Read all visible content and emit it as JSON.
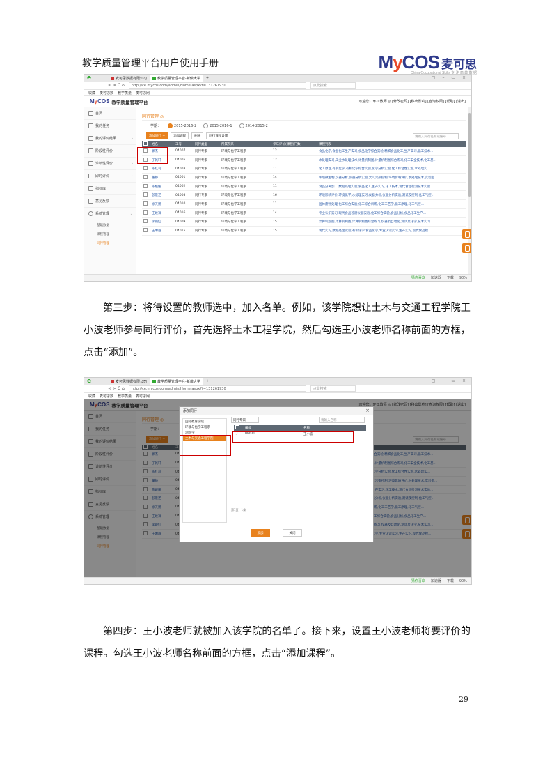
{
  "header": {
    "doc_title": "教学质量管理平台用户使用手册",
    "logo_en_1": "M",
    "logo_en_2": "y",
    "logo_en_3": "COS",
    "logo_cn": "麦可思",
    "logo_sub": "China Occupational Skills  专 注  高 教 数 据"
  },
  "browser": {
    "tab1": "麦可思数据有限公司",
    "tab2": "教学质量管理平台-新做大学",
    "tab_new": "+",
    "window_controls": "▢ – ▭ ×",
    "nav_icons": "<  >  C  ⌂",
    "url": "http://ce.mycos.com/admin/Home.aspx?t=131261930",
    "search_placeholder": "点此搜索",
    "bookmarks": [
      "收藏",
      "麦可思数",
      "教学质量",
      "麦可思网"
    ],
    "status_items": [
      "猜你喜欢",
      "加速器",
      "下载",
      "90%"
    ]
  },
  "app": {
    "logo_m": "M",
    "logo_y": "y",
    "logo_cos": "COS",
    "title": "教学质量管理平台",
    "userbar": "欢迎您，环工教师 ◎  [修改密码] [移出影响] [查询权限] [帮助] [退出]"
  },
  "sidebar": {
    "items": [
      {
        "label": "首页"
      },
      {
        "label": "我的任务"
      },
      {
        "label": "我的评价结果"
      },
      {
        "label": "阶段性评价"
      },
      {
        "label": "诊断性评价"
      },
      {
        "label": "即时评价"
      },
      {
        "label": "指标库"
      },
      {
        "label": "意见反馈"
      },
      {
        "label": "系统管理"
      }
    ],
    "subitems": [
      "基础数据",
      "课程管理",
      "同行管理"
    ]
  },
  "content": {
    "breadcrumb": "同行管理 ◎",
    "term_label": "学期：",
    "terms": [
      "2015-2016-2",
      "2015-2016-1",
      "2014-2015-2"
    ],
    "buttons": [
      "添加同行 +",
      "添加课程",
      "删除",
      "同行课程设置"
    ],
    "filter_placeholder": "请输入同行名称或编号",
    "columns": [
      "",
      "姓名",
      "工号",
      "同行类型",
      "所属院系",
      "参与评价(课程)门数",
      "课程列表"
    ],
    "rows": [
      [
        "郭杰",
        "04007",
        "同行专家",
        "环境与化学工程系",
        "12",
        "食品化学,食品化工生产实习,食品化学综合实验,精细食品化工,生产实习,化工技术..."
      ],
      [
        "丁乾轩",
        "04005",
        "同行专家",
        "环境与化学工程系",
        "12",
        "水处理实习,工业水处理技术,计量机制图,计量机制图综合练习,化工安全技术,化工基..."
      ],
      [
        "陈红莉",
        "04003",
        "同行专家",
        "环境与化学工程系",
        "11",
        "化工原理,有机化学,有机化学综合实验,化学分析实验,化工综合性实验,水处理实..."
      ],
      [
        "董静",
        "04001",
        "同行专家",
        "环境与化学工程系",
        "14",
        "环境微生物,仪器分析,仪器分析实验,大气污染控制,环境影响评价,水处理技术,实验室..."
      ],
      [
        "陈媛媛",
        "04002",
        "同行专家",
        "环境与化学工程系",
        "11",
        "食品分离加工,数据处理实验,食品化工,生产实习,化工技术,现代食品检测技术实验..."
      ],
      [
        "彭景芝",
        "04008",
        "同行专家",
        "环境与化学工程系",
        "16",
        "环境影响评价,环境化学,水处理实习,仪器分析,仪器分析实验,测试及控制,化工气控..."
      ],
      [
        "徐天鹏",
        "04010",
        "同行专家",
        "环境与化学工程系",
        "11",
        "固体废物处理,化工综合实验,化工综合训练,化工工艺学,化工原理,化工气控..."
      ],
      [
        "王焕祥",
        "04016",
        "同行专家",
        "环境与化学工程系",
        "14",
        "专业认识实习,现代食品检测仪器实验,化工综合实验,食品分析,食品化工生产..."
      ],
      [
        "李艳红",
        "04009",
        "同行专家",
        "环境与化学工程系",
        "15",
        "计算机绘图,计算机制图,计算机制图综合练习,仪器及自动化,测试及化学,技术实习..."
      ],
      [
        "王琳霞",
        "04015",
        "同行专家",
        "环境与化学工程系",
        "15",
        "现代实习,数据处理试验,有机化学,食品化学,专业认识实习,生产实习,现代食品检..."
      ]
    ]
  },
  "modal": {
    "title": "添加同行",
    "close": "×",
    "colleges": [
      "国际教育学院",
      "环境与化学工程系",
      "测绘学",
      "土木与交通工程学院"
    ],
    "type_select": "同行专家",
    "name_placeholder": "请输入名称",
    "columns": [
      "",
      "编号",
      "名称"
    ],
    "row": [
      "09021",
      "王小波"
    ],
    "footer": "第1页，1条",
    "add_btn": "添加",
    "close_btn": "关闭"
  },
  "body": {
    "step3": "第三步：将待设置的教师选中，加入名单。例如，该学院想让土木与交通工程学院王小波老师参与同行评价，首先选择土木工程学院，然后勾选王小波老师名称前面的方框，点击“添加”。",
    "step4": "第四步：王小波老师就被加入该学院的名单了。接下来，设置王小波老师将要评价的课程。勾选王小波老师名称前面的方框，点击“添加课程”。"
  },
  "page_number": "29"
}
